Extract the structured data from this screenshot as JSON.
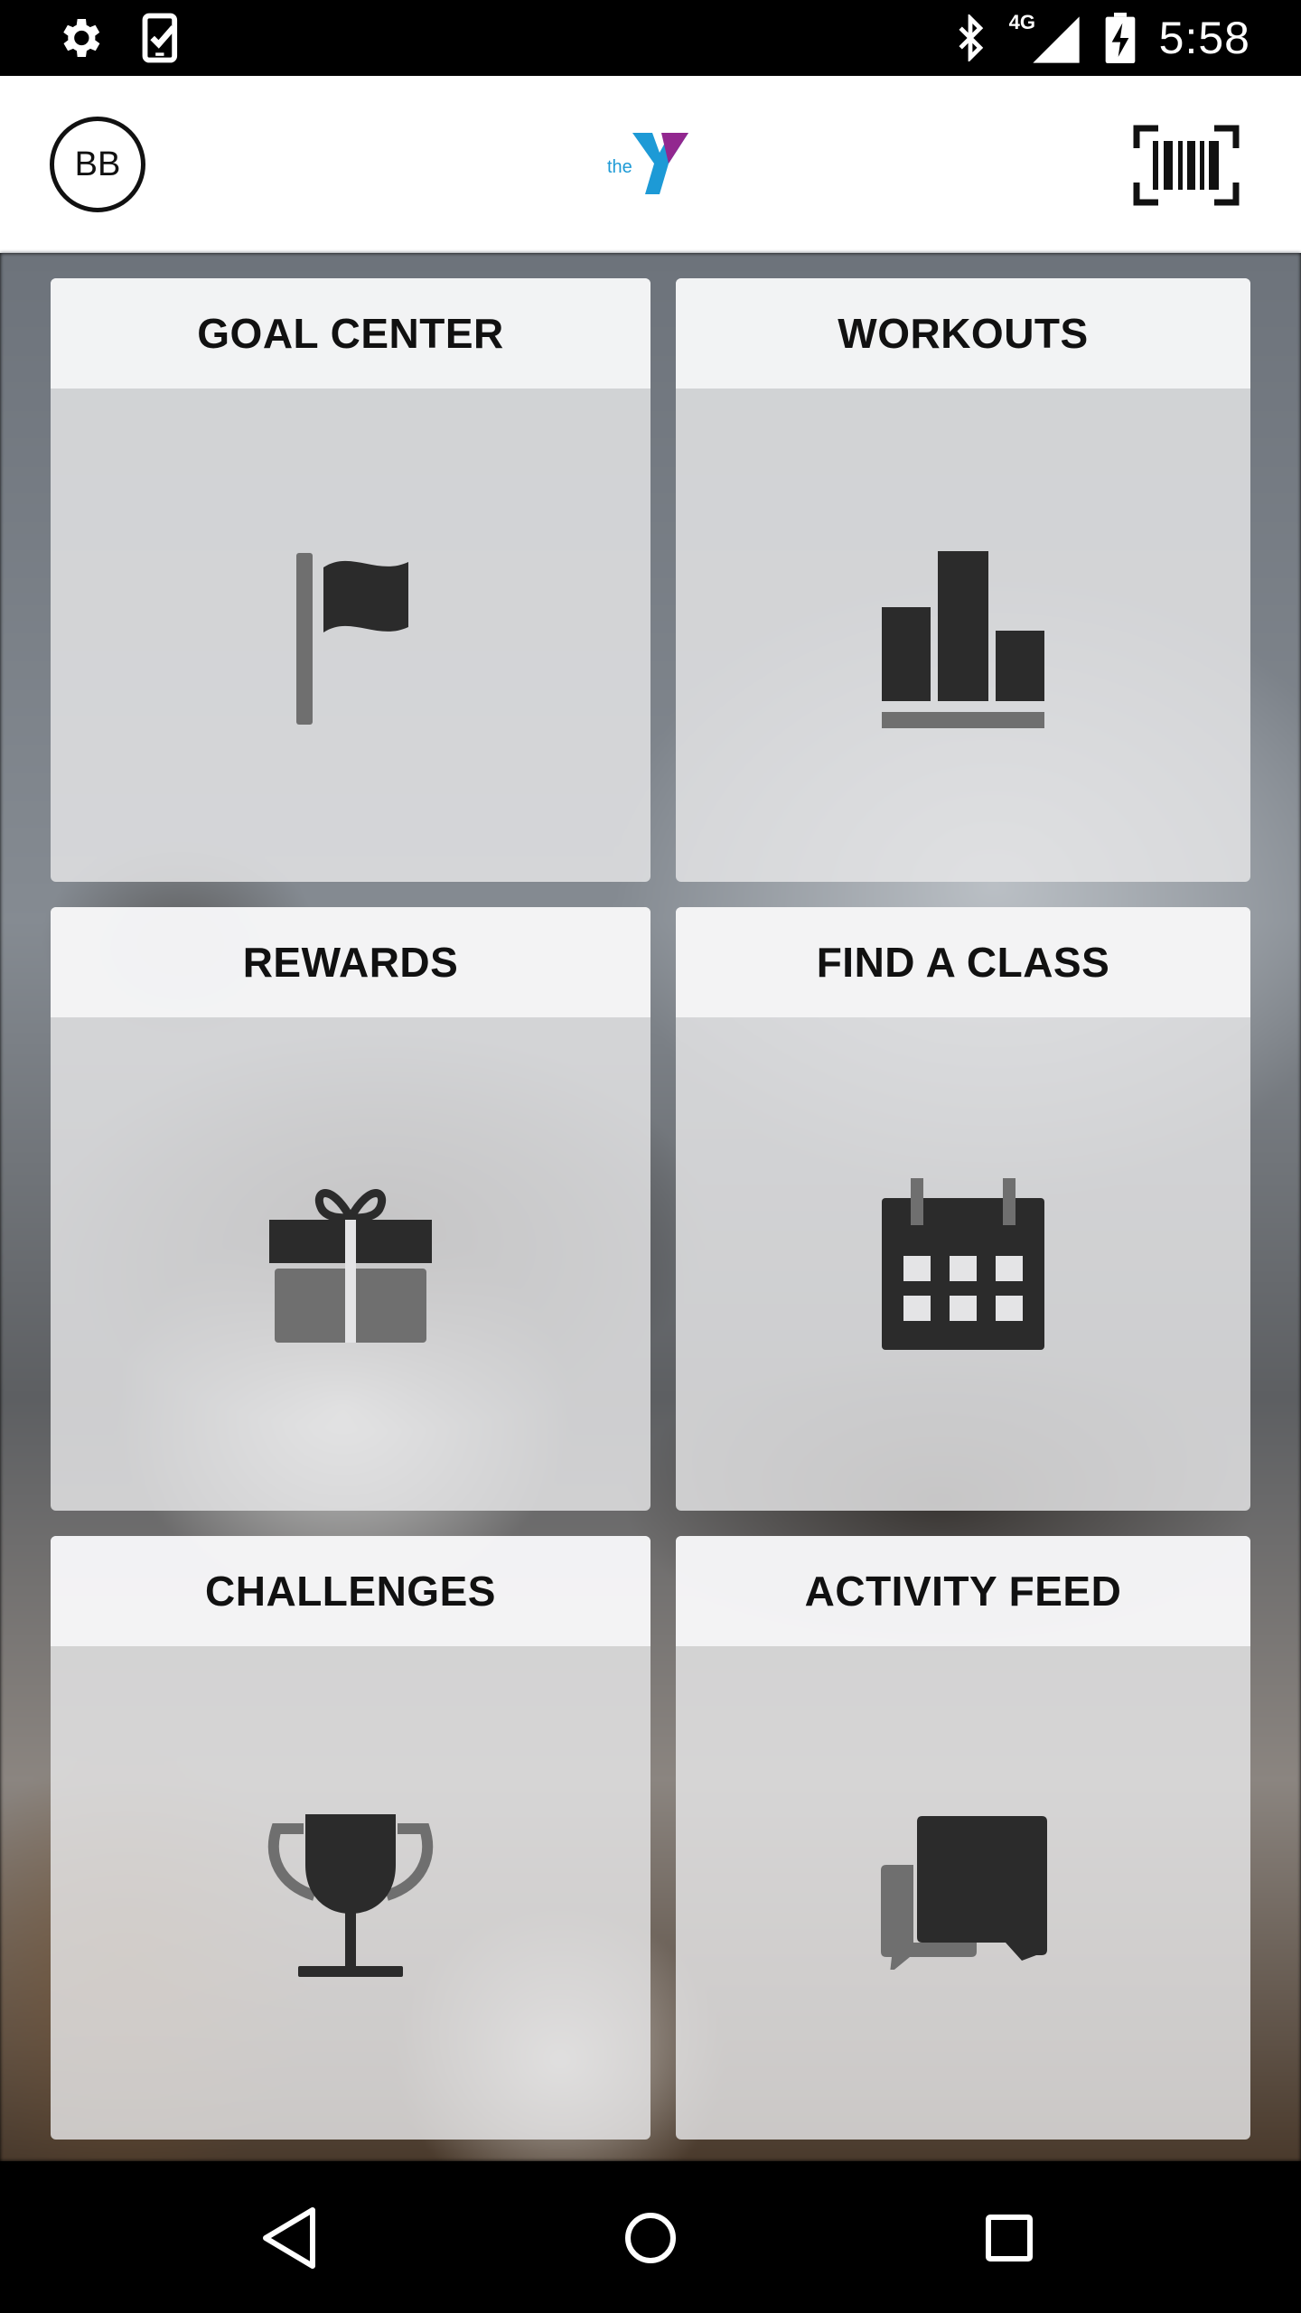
{
  "status_bar": {
    "time": "5:58",
    "network": "4G",
    "icons": [
      "settings-icon",
      "task-check-icon",
      "bluetooth-icon",
      "signal-icon",
      "battery-charging-icon"
    ]
  },
  "header": {
    "avatar_initials": "BB",
    "logo": {
      "text": "the",
      "name": "ymca-logo",
      "colors": {
        "blue": "#1d9ad6",
        "purple": "#92278f"
      }
    },
    "barcode_icon": "barcode-scan-icon"
  },
  "tiles": [
    {
      "id": "goal-center",
      "label": "GOAL CENTER",
      "icon": "flag-icon"
    },
    {
      "id": "workouts",
      "label": "WORKOUTS",
      "icon": "bar-chart-icon"
    },
    {
      "id": "rewards",
      "label": "REWARDS",
      "icon": "gift-icon"
    },
    {
      "id": "find-a-class",
      "label": "FIND A CLASS",
      "icon": "calendar-icon"
    },
    {
      "id": "challenges",
      "label": "CHALLENGES",
      "icon": "trophy-icon"
    },
    {
      "id": "activity-feed",
      "label": "ACTIVITY FEED",
      "icon": "chat-bubbles-icon"
    }
  ],
  "nav_bar": {
    "icons": [
      "back-icon",
      "home-icon",
      "recents-icon"
    ]
  },
  "colors": {
    "icon_dark": "#2b2b2b",
    "icon_mid": "#6f6f6f",
    "tile_header_bg": "#f4f4f5"
  }
}
